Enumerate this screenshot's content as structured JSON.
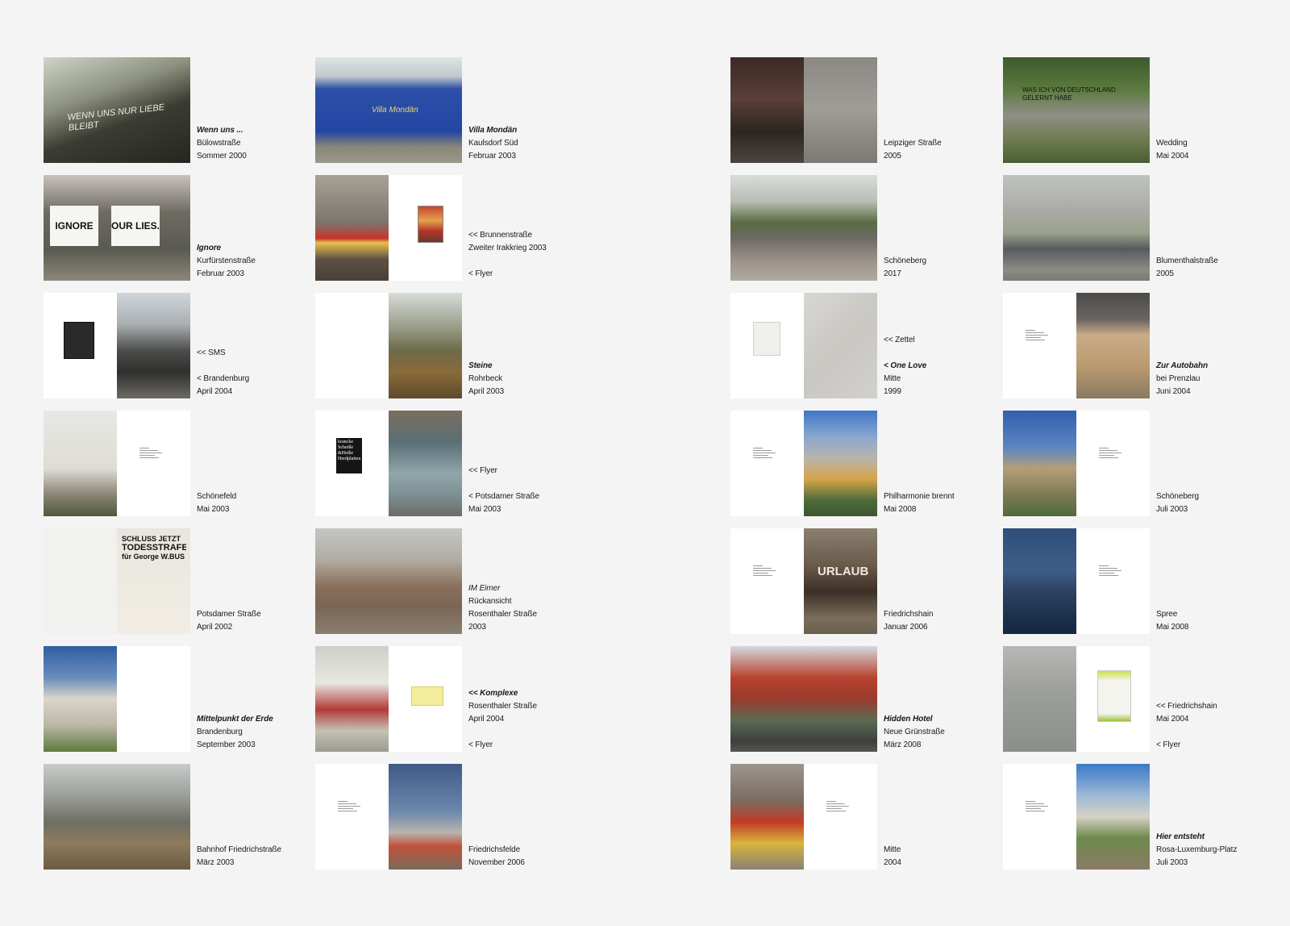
{
  "photo_tiles": [
    {
      "name": "wenn-uns",
      "lines": [
        {
          "text": "Wenn uns ...",
          "style": "title"
        },
        {
          "text": "Bülowstraße"
        },
        {
          "text": "Sommer 2000"
        }
      ],
      "pages": [
        {
          "w": "full",
          "color": "linear-gradient(160deg,#cfd4c6 0%,#8d917f 35%,#3a3d33 60%,#25271f 100%)"
        }
      ],
      "scrawl": "WENN UNS NUR LIEBE BLEIBT"
    },
    {
      "name": "ignore",
      "lines": [
        {
          "text": "Ignore",
          "style": "title"
        },
        {
          "text": "Kurfürstenstraße"
        },
        {
          "text": "Februar 2003"
        }
      ],
      "pages": [
        {
          "w": "full",
          "color": "linear-gradient(180deg,#c9c2bd 0%,#6f6b63 35%,#5a5a52 70%,#8c8778 100%)"
        }
      ],
      "signs": [
        "IGNORE",
        "OUR LIES."
      ]
    },
    {
      "name": "sms",
      "lines": [
        {
          "text": "<< SMS"
        },
        {
          "text": ""
        },
        {
          "text": "< Brandenburg"
        },
        {
          "text": "April 2004"
        }
      ],
      "pages": [
        {
          "w": "half",
          "color": "#ffffff",
          "insetType": "dark"
        },
        {
          "w": "half",
          "color": "linear-gradient(180deg,#cfd6dc 0%,#a9aeb0 30%,#4c4d4a 55%,#2f2f2d 75%,#6d6b65 100%)"
        }
      ]
    },
    {
      "name": "schoenefeld",
      "lines": [
        {
          "text": "Schönefeld"
        },
        {
          "text": "Mai 2003"
        }
      ],
      "pages": [
        {
          "w": "half",
          "color": "linear-gradient(180deg,#e8e8e4 0%,#dedcd5 55%,#8a8272 80%,#4f5a3c 100%)"
        },
        {
          "w": "half",
          "color": "#ffffff",
          "insetType": "text"
        }
      ]
    },
    {
      "name": "potsdamer-strasse-2002",
      "lines": [
        {
          "text": "Potsdamer Straße"
        },
        {
          "text": "April 2002"
        }
      ],
      "pages": [
        {
          "w": "half",
          "color": "#f1f1ef"
        },
        {
          "w": "half",
          "color": "linear-gradient(180deg,#e9e6df 0%,#f1ede4 100%)",
          "insetType": "poster"
        }
      ],
      "poster": [
        "SCHLUSS JETZT",
        "TODESSTRAFE",
        "für George W.BUS"
      ]
    },
    {
      "name": "mittelpunkt-der-erde",
      "lines": [
        {
          "text": "Mittelpunkt der Erde",
          "style": "title"
        },
        {
          "text": "Brandenburg"
        },
        {
          "text": "September 2003"
        }
      ],
      "pages": [
        {
          "w": "half",
          "color": "linear-gradient(180deg,#2e5fa2 0%,#6a8dbc 30%,#d9d6cb 50%,#bdb6a6 75%,#5a7b3c 100%)"
        },
        {
          "w": "half",
          "color": "#ffffff"
        }
      ]
    },
    {
      "name": "bahnhof-friedrichstrasse",
      "lines": [
        {
          "text": "Bahnhof Friedrichstraße"
        },
        {
          "text": "März 2003"
        }
      ],
      "pages": [
        {
          "w": "full",
          "color": "linear-gradient(180deg,#c6ccc9 0%,#9c9f9a 30%,#6f6e64 55%,#8d7a5c 75%,#6b5b42 100%)"
        }
      ]
    },
    {
      "name": "villa-mondaen",
      "lines": [
        {
          "text": "Villa Mondän",
          "style": "title"
        },
        {
          "text": "Kaulsdorf Süd"
        },
        {
          "text": "Februar 2003"
        }
      ],
      "pages": [
        {
          "w": "full",
          "color": "linear-gradient(180deg,#dfe4e6 0%,#c2c8cb 18%,#2c4fa8 30%,#2346a3 70%,#8a8778 85%,#9b9789 100%)"
        }
      ],
      "sign": "Villa Mondän"
    },
    {
      "name": "brunnenstrasse",
      "lines": [
        {
          "text": "<< Brunnenstraße"
        },
        {
          "text": "Zweiter Irakkrieg 2003"
        },
        {
          "text": ""
        },
        {
          "text": "< Flyer"
        }
      ],
      "pages": [
        {
          "w": "half",
          "color": "linear-gradient(180deg,#a7a196 0%,#7d766c 45%,#c7342a 60%,#e8c14a 64%,#5d4f45 80%,#4a4037 100%)"
        },
        {
          "w": "half",
          "color": "#ffffff",
          "insetType": "flyer"
        }
      ]
    },
    {
      "name": "steine",
      "lines": [
        {
          "text": "Steine",
          "style": "title"
        },
        {
          "text": "Rohrbeck"
        },
        {
          "text": "April 2003"
        }
      ],
      "pages": [
        {
          "w": "half",
          "color": "#ffffff"
        },
        {
          "w": "half",
          "color": "linear-gradient(180deg,#d7dcd9 0%,#9ea28f 30%,#6d6a4a 55%,#8a6a3a 75%,#5e4a2c 100%)"
        }
      ]
    },
    {
      "name": "potsdamer-strasse-2003",
      "lines": [
        {
          "text": "<< Flyer"
        },
        {
          "text": ""
        },
        {
          "text": "< Potsdamer Straße"
        },
        {
          "text": "Mai 2003"
        }
      ],
      "pages": [
        {
          "w": "half",
          "color": "#ffffff",
          "insetType": "bookcover"
        },
        {
          "w": "half",
          "color": "linear-gradient(180deg,#7a6d5d 0%,#5a6f76 30%,#8fa6ab 60%,#7d8f91 80%,#6b6b66 100%)"
        }
      ],
      "bookcover": [
        "krancke",
        "Scheiße",
        "&Heiße",
        "Herdplatten"
      ]
    },
    {
      "name": "im-eimer",
      "lines": [
        {
          "text": "IM Eimer",
          "style": "italic"
        },
        {
          "text": "Rückansicht"
        },
        {
          "text": "Rosenthaler Straße"
        },
        {
          "text": "2003"
        }
      ],
      "pages": [
        {
          "w": "full",
          "color": "linear-gradient(180deg,#c4c6c4 0%,#b1aca2 30%,#8a6f5a 55%,#7a6654 75%,#8a7f72 100%)"
        }
      ]
    },
    {
      "name": "komplexe",
      "lines": [
        {
          "text": "<< Komplexe",
          "style": "title"
        },
        {
          "text": "Rosenthaler Straße"
        },
        {
          "text": "April 2004"
        },
        {
          "text": ""
        },
        {
          "text": "< Flyer"
        }
      ],
      "pages": [
        {
          "w": "half",
          "color": "linear-gradient(180deg,#cfcfca 0%,#e8e6e0 35%,#b23b36 60%,#c6c1b5 80%,#9c9a93 100%)"
        },
        {
          "w": "half",
          "color": "#ffffff",
          "insetType": "yellownote"
        }
      ]
    },
    {
      "name": "friedrichsfelde",
      "lines": [
        {
          "text": "Friedrichsfelde"
        },
        {
          "text": "November 2006"
        }
      ],
      "pages": [
        {
          "w": "half",
          "color": "#ffffff",
          "insetType": "text"
        },
        {
          "w": "half",
          "color": "linear-gradient(180deg,#3e5a86 0%,#6d87ad 45%,#b8b5ae 65%,#c0523a 78%,#7a6a5a 100%)"
        }
      ]
    },
    {
      "name": "leipziger-strasse",
      "lines": [
        {
          "text": "Leipziger Straße"
        },
        {
          "text": "2005"
        }
      ],
      "pages": [
        {
          "w": "half",
          "color": "linear-gradient(180deg,#3a2a24 0%,#5a4038 40%,#2c2622 70%,#4b4440 100%)"
        },
        {
          "w": "half",
          "color": "linear-gradient(180deg,#8c8884 0%,#a09c96 50%,#7c7873 100%)"
        }
      ]
    },
    {
      "name": "schoeneberg-2017",
      "lines": [
        {
          "text": "Schöneberg"
        },
        {
          "text": "2017"
        }
      ],
      "pages": [
        {
          "w": "full",
          "color": "linear-gradient(180deg,#d9dcda 0%,#b9bdb3 25%,#5a6b44 45%,#6d6a64 60%,#9a9087 80%,#b0aaa0 100%)"
        }
      ]
    },
    {
      "name": "one-love",
      "lines": [
        {
          "text": "<< Zettel"
        },
        {
          "text": ""
        },
        {
          "text": "< One Love",
          "style": "title"
        },
        {
          "text": "Mitte"
        },
        {
          "text": "1999"
        }
      ],
      "pages": [
        {
          "w": "half",
          "color": "#ffffff",
          "insetType": "paper"
        },
        {
          "w": "half",
          "color": "linear-gradient(135deg,#d9d7d3 0%,#c9c7c2 50%,#d2d0cc 100%)"
        }
      ]
    },
    {
      "name": "philharmonie-brennt",
      "lines": [
        {
          "text": "Philharmonie brennt"
        },
        {
          "text": "Mai 2008"
        }
      ],
      "pages": [
        {
          "w": "half",
          "color": "#ffffff",
          "insetType": "text"
        },
        {
          "w": "half",
          "color": "linear-gradient(180deg,#3f76c7 0%,#8aa7cf 25%,#b9b4ad 45%,#d6a448 65%,#4e6b3a 85%,#3e5530 100%)"
        }
      ]
    },
    {
      "name": "friedrichshain",
      "lines": [
        {
          "text": "Friedrichshain"
        },
        {
          "text": "Januar 2006"
        }
      ],
      "pages": [
        {
          "w": "half",
          "color": "#ffffff",
          "insetType": "text"
        },
        {
          "w": "half",
          "color": "linear-gradient(180deg,#8a8070 0%,#6a5a4a 35%,#3c2f27 60%,#7a6d5a 85%,#6b5f50 100%)"
        }
      ],
      "door": "URLAUB"
    },
    {
      "name": "hidden-hotel",
      "lines": [
        {
          "text": "Hidden Hotel",
          "style": "title"
        },
        {
          "text": "Neue Grünstraße"
        },
        {
          "text": "März 2008"
        }
      ],
      "pages": [
        {
          "w": "full",
          "color": "linear-gradient(180deg,#d3d9de 0%,#b8422f 30%,#9a3b2e 50%,#5c6a53 70%,#3e3f3c 90%,#555550 100%)"
        }
      ]
    },
    {
      "name": "mitte-2004",
      "lines": [
        {
          "text": "Mitte"
        },
        {
          "text": "2004"
        }
      ],
      "pages": [
        {
          "w": "half",
          "color": "linear-gradient(180deg,#9c9690 0%,#7b6c60 35%,#c23a28 55%,#d9b53a 75%,#8a8175 100%)"
        },
        {
          "w": "half",
          "color": "#ffffff",
          "insetType": "text"
        }
      ]
    },
    {
      "name": "wedding",
      "lines": [
        {
          "text": "Wedding"
        },
        {
          "text": "Mai 2004"
        }
      ],
      "pages": [
        {
          "w": "full",
          "color": "linear-gradient(180deg,#3c5a2c 0%,#5b7a3e 30%,#8f8f86 55%,#6b7a4c 80%,#4a5e33 100%)"
        }
      ],
      "scrawl": "WAS ICH VON DEUTSCHLAND GELERNT HABE"
    },
    {
      "name": "blumenthalstrasse",
      "lines": [
        {
          "text": "Blumenthalstraße"
        },
        {
          "text": "2005"
        }
      ],
      "pages": [
        {
          "w": "full",
          "color": "linear-gradient(180deg,#bfc3c0 0%,#a9aaa4 35%,#9aa08a 55%,#565b5e 70%,#8c8c86 90%,#7a7a73 100%)"
        }
      ]
    },
    {
      "name": "zur-autobahn",
      "lines": [
        {
          "text": "Zur Autobahn",
          "style": "title"
        },
        {
          "text": "bei Prenzlau"
        },
        {
          "text": "Juni 2004"
        }
      ],
      "pages": [
        {
          "w": "half",
          "color": "#ffffff",
          "insetType": "text"
        },
        {
          "w": "half",
          "color": "linear-gradient(180deg,#4c4a48 0%,#6a6561 25%,#c9ac86 40%,#b9996f 70%,#8a7a62 100%)"
        }
      ]
    },
    {
      "name": "schoeneberg-2003",
      "lines": [
        {
          "text": "Schöneberg"
        },
        {
          "text": "Juli 2003"
        }
      ],
      "pages": [
        {
          "w": "half",
          "color": "linear-gradient(180deg,#2f5fae 0%,#5d85c0 35%,#b39e78 55%,#7c7a56 80%,#4e6a3a 100%)"
        },
        {
          "w": "half",
          "color": "#ffffff",
          "insetType": "text"
        }
      ]
    },
    {
      "name": "spree",
      "lines": [
        {
          "text": "Spree"
        },
        {
          "text": "Mai 2008"
        }
      ],
      "pages": [
        {
          "w": "half",
          "color": "linear-gradient(180deg,#2f4e7a 0%,#3e5d86 40%,#2b4262 60%,#1e3350 80%,#152740 100%)"
        },
        {
          "w": "half",
          "color": "#ffffff",
          "insetType": "text"
        }
      ]
    },
    {
      "name": "friedrichshain-2004",
      "lines": [
        {
          "text": "<< Friedrichshain"
        },
        {
          "text": "Mai 2004"
        },
        {
          "text": ""
        },
        {
          "text": "< Flyer"
        }
      ],
      "pages": [
        {
          "w": "half",
          "color": "linear-gradient(180deg,#b7b8b5 0%,#9ea09b 40%,#8c8e89 100%)"
        },
        {
          "w": "half",
          "color": "#ffffff",
          "insetType": "greenflyer"
        }
      ]
    },
    {
      "name": "hier-entsteht",
      "lines": [
        {
          "text": "Hier entsteht",
          "style": "title"
        },
        {
          "text": "Rosa-Luxemburg-Platz"
        },
        {
          "text": "Juli 2003"
        }
      ],
      "pages": [
        {
          "w": "half",
          "color": "#ffffff",
          "insetType": "text"
        },
        {
          "w": "half",
          "color": "linear-gradient(180deg,#3a7ac7 0%,#9cb9d6 30%,#d6d2c5 50%,#6e8a4c 70%,#8a7a66 100%)"
        }
      ]
    }
  ]
}
